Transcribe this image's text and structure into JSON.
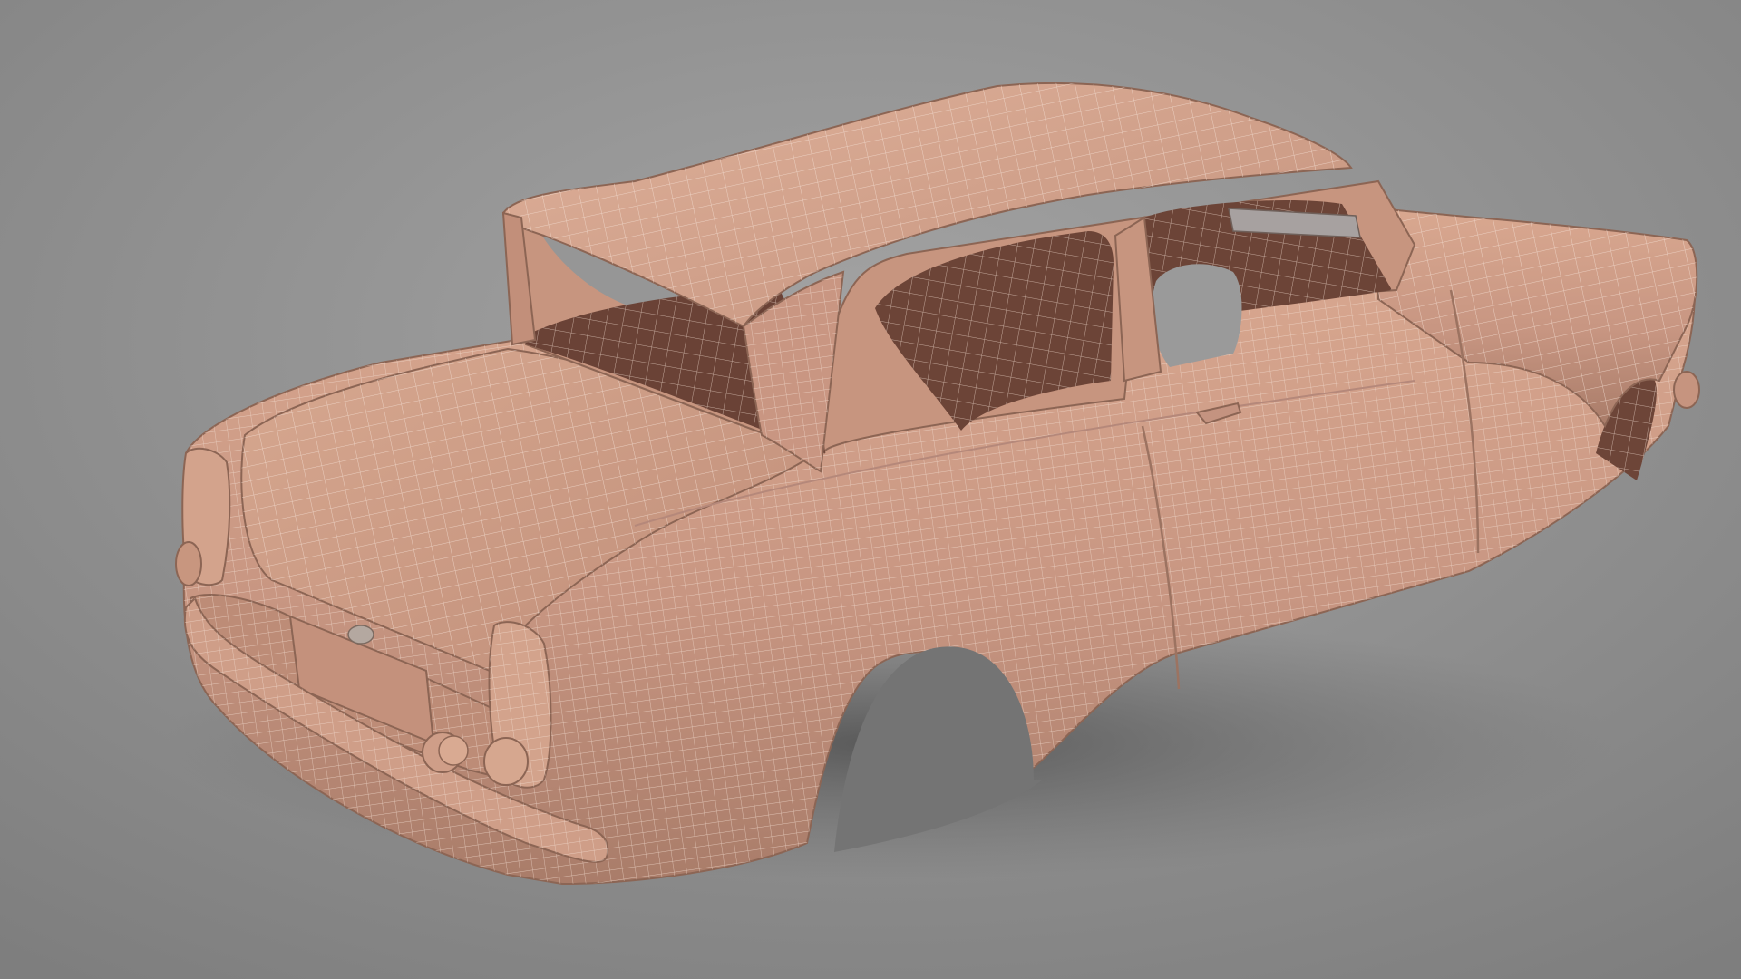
{
  "scene": {
    "subject": "car-body-wireframe-render",
    "colors": {
      "background_light": "#a3a3a3",
      "background_dark": "#7e7e7e",
      "clay": "#c99881",
      "clay_light": "#dcad96",
      "clay_shadow": "#9c6f5b",
      "interior": "#6b4336",
      "wire": "#f1d9cc",
      "floor_shadow": "#5f5f5f"
    }
  }
}
